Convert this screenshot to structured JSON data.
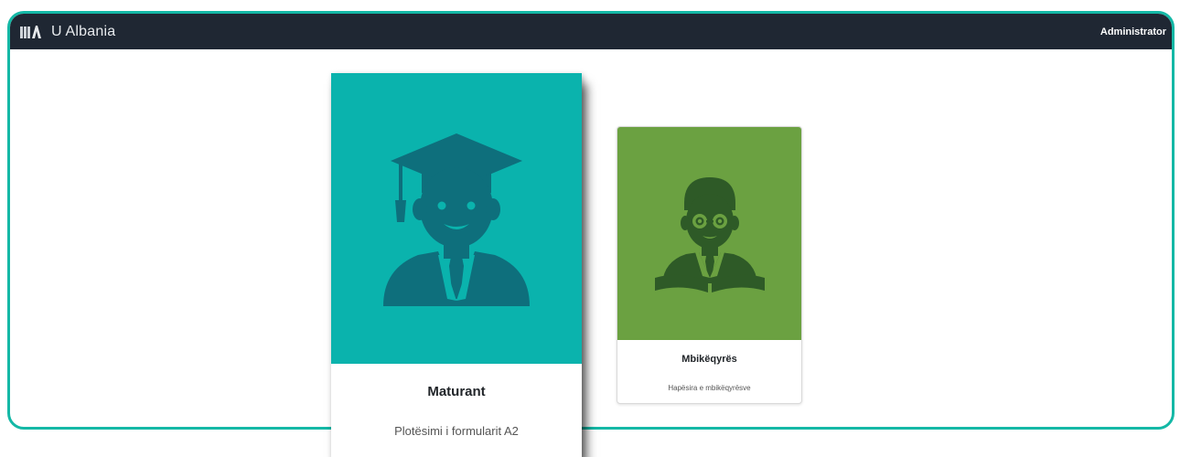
{
  "app": {
    "brand_name": "U Albania",
    "logo_icon": "books-logo-icon"
  },
  "navbar": {
    "user_label": "Administrator"
  },
  "cards": [
    {
      "title": "Maturant",
      "text": "Plotësimi i formularit A2",
      "icon": "graduate-icon",
      "color": "#0ab3ad"
    },
    {
      "title": "Mbikëqyrës",
      "text": "Hapësira e mbikëqyrësve",
      "icon": "teacher-reading-icon",
      "color": "#6ba141"
    }
  ],
  "colors": {
    "navbar": "#1f2733",
    "frame_border": "#14b8a6"
  }
}
